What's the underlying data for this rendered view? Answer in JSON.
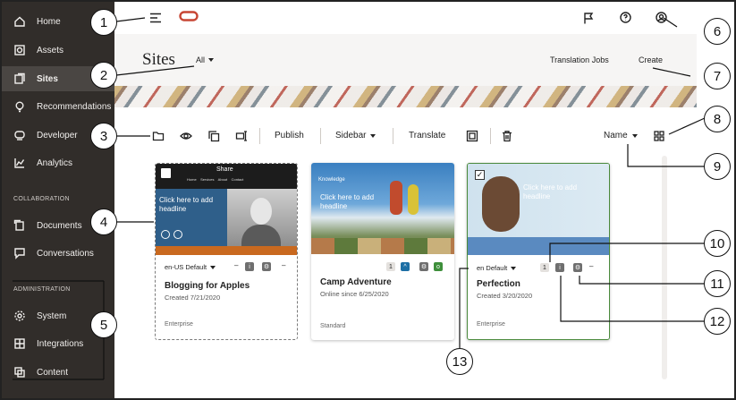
{
  "sidebar": {
    "items": [
      {
        "label": "Home",
        "icon": "home-icon"
      },
      {
        "label": "Assets",
        "icon": "assets-icon"
      },
      {
        "label": "Sites",
        "icon": "sites-icon"
      },
      {
        "label": "Recommendations",
        "icon": "bulb-icon"
      },
      {
        "label": "Developer",
        "icon": "developer-icon"
      },
      {
        "label": "Analytics",
        "icon": "analytics-icon"
      }
    ],
    "collaboration_label": "COLLABORATION",
    "collab_items": [
      {
        "label": "Documents",
        "icon": "documents-icon"
      },
      {
        "label": "Conversations",
        "icon": "conversations-icon"
      }
    ],
    "administration_label": "ADMINISTRATION",
    "admin_items": [
      {
        "label": "System",
        "icon": "gear-icon"
      },
      {
        "label": "Integrations",
        "icon": "integrations-icon"
      },
      {
        "label": "Content",
        "icon": "content-icon"
      }
    ]
  },
  "header": {
    "title": "Sites",
    "filter": "All",
    "translation_jobs": "Translation Jobs",
    "create": "Create"
  },
  "toolbar": {
    "publish": "Publish",
    "sidebar": "Sidebar",
    "translate": "Translate",
    "sort": "Name"
  },
  "cards": [
    {
      "name": "Blogging for Apples",
      "date": "Created 7/21/2020",
      "type": "Enterprise",
      "language": "en-US Default",
      "thumb_title": "Share",
      "thumb_nav": "Home    Services    About    Contact",
      "thumb_headline": "Click here to add headline"
    },
    {
      "name": "Camp Adventure",
      "date": "Online since 6/25/2020",
      "type": "Standard",
      "thumb_headline": "Click here to add headline",
      "thumb_sub": "Knowledge",
      "badge_count": "1"
    },
    {
      "name": "Perfection",
      "date": "Created 3/20/2020",
      "type": "Enterprise",
      "language": "en Default",
      "thumb_headline": "Click here to add headline",
      "badge_count": "1"
    }
  ],
  "callouts": [
    "1",
    "2",
    "3",
    "4",
    "5",
    "6",
    "7",
    "8",
    "9",
    "10",
    "11",
    "12",
    "13"
  ],
  "colors": {
    "sidebar_bg": "#312d2a",
    "oracle_red": "#c74634",
    "selected_border": "#4a8a3c"
  }
}
